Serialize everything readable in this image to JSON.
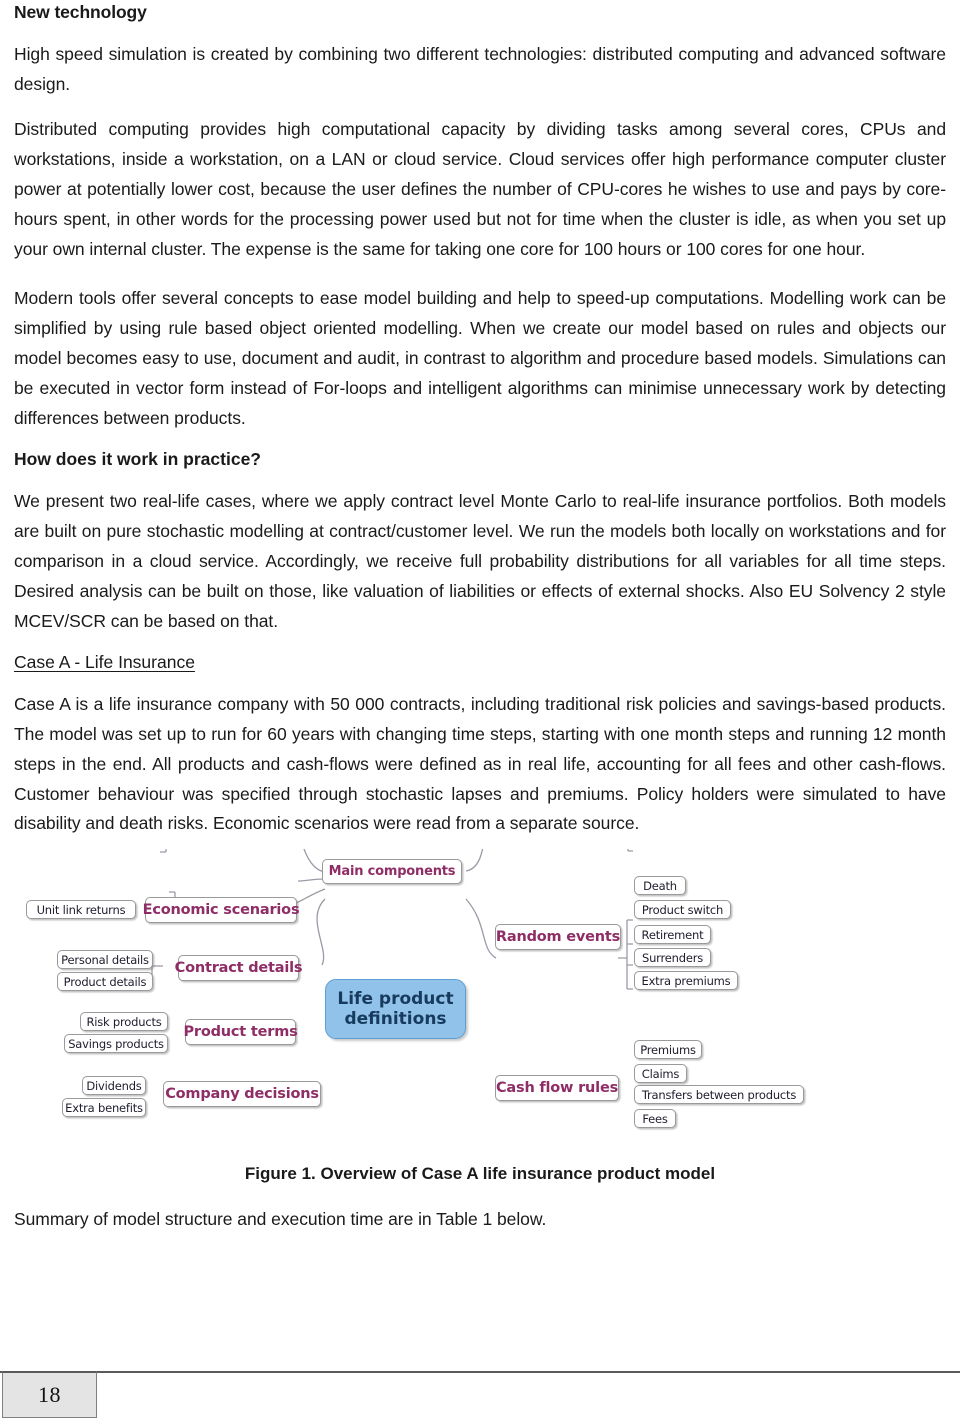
{
  "document": {
    "page_number": "18",
    "heading": "New technology",
    "paragraphs": [
      "High speed simulation is created by combining two different technologies: distributed computing and advanced software design.",
      "Distributed computing provides high computational capacity by dividing tasks among several cores, CPUs and workstations, inside a workstation, on a LAN or cloud service.  Cloud services offer high performance computer cluster power at potentially lower cost, because the user defines the number of CPU-cores he wishes to use and pays by core-hours spent, in other words for the processing power used but not for time when the cluster is idle, as when you set up your own internal cluster. The expense is the same for taking one core for 100 hours or 100 cores for one hour.",
      "Modern tools offer several concepts to ease model building and help to speed-up computations. Modelling work can be simplified by using rule based object oriented modelling. When we create our model based on rules and objects our model becomes easy to use, document and audit, in contrast to algorithm and procedure based models. Simulations can be executed in vector form instead of For-loops and intelligent algorithms can minimise unnecessary work by detecting differences between products."
    ],
    "practice_heading": "How does it work in practice?",
    "practice_paragraph": "We present two real-life cases, where we apply contract level Monte Carlo to real-life insurance portfolios. Both models are built on pure stochastic modelling at contract/customer level. We run the models both locally on workstations and for comparison in a cloud service. Accordingly, we receive full probability distributions for all variables for all time steps. Desired analysis can be built on those, like valuation of liabilities or effects of external shocks. Also EU Solvency 2 style MCEV/SCR can  be based on that.",
    "case_heading": "Case A - Life Insurance",
    "case_paragraph": "Case A is a life insurance company with 50 000 contracts, including traditional risk policies and savings-based products. The model was set up to run for 60 years with changing time steps, starting with one month steps and running 12 month steps in the end. All products and cash-flows were defined as in real life, accounting for all fees and other cash-flows. Customer behaviour was specified through stochastic lapses and premiums. Policy holders were simulated to have disability and death risks. Economic scenarios were read from a separate source.",
    "figure_caption": "Figure 1. Overview of Case A life insurance product model",
    "closing_paragraph": "Summary of model structure and execution time are in Table 1 below."
  },
  "figure": {
    "title_node": "Main components",
    "center_node_line1": "Life product",
    "center_node_line2": "definitions",
    "colors": {
      "center_fill": "#91c3ea",
      "center_border": "#5d9fd4",
      "center_text": "#173a5e",
      "branch_text": "#8f2d66",
      "leaf_text": "#1d1d2e",
      "node_border": "#9a9a9a",
      "connector": "#9a9aa6"
    },
    "branches": [
      {
        "label": "Economic scenarios",
        "side": "left",
        "children": [
          "Unit link returns"
        ]
      },
      {
        "label": "Contract details",
        "side": "left",
        "children": [
          "Personal details",
          "Product details"
        ]
      },
      {
        "label": "Product terms",
        "side": "left",
        "children": [
          "Risk products",
          "Savings products"
        ]
      },
      {
        "label": "Company decisions",
        "side": "left",
        "children": [
          "Dividends",
          "Extra benefits"
        ]
      },
      {
        "label": "Random events",
        "side": "right",
        "children": [
          "Death",
          "Product switch",
          "Retirement",
          "Surrenders",
          "Extra premiums"
        ]
      },
      {
        "label": "Cash flow rules",
        "side": "right",
        "children": [
          "Premiums",
          "Claims",
          "Transfers between products",
          "Fees"
        ]
      }
    ]
  }
}
